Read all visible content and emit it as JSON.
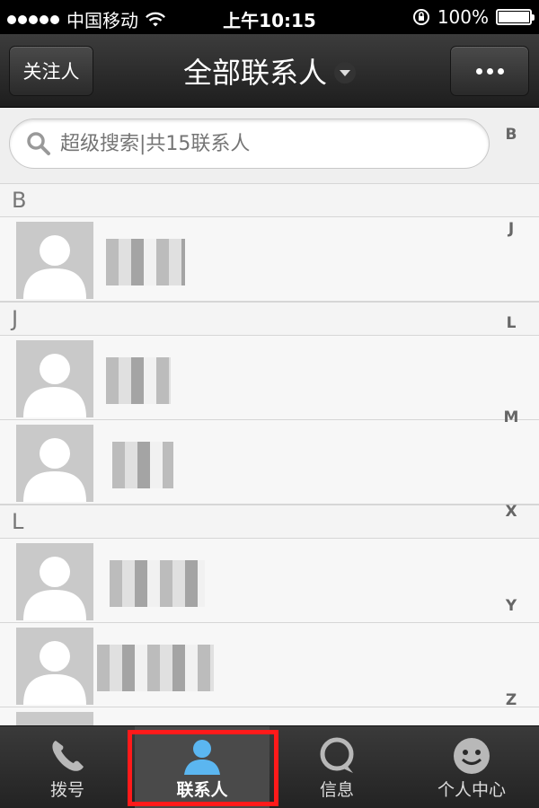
{
  "status_bar": {
    "carrier": "中国移动",
    "time": "上午10:15",
    "battery": "100%",
    "battery_level": 1.0
  },
  "nav": {
    "left_button": "关注人",
    "title": "全部联系人",
    "right_icon": "more-dots-icon"
  },
  "search": {
    "placeholder": "超级搜索|共15联系人",
    "icon": "search-icon"
  },
  "sections": [
    {
      "letter": "B",
      "contacts": [
        {
          "name_obscured": true
        }
      ]
    },
    {
      "letter": "J",
      "contacts": [
        {
          "name_obscured": true
        },
        {
          "name_obscured": true
        }
      ]
    },
    {
      "letter": "L",
      "contacts": [
        {
          "name_obscured": true
        },
        {
          "name_obscured": true
        },
        {
          "name_obscured": true
        }
      ]
    }
  ],
  "index": [
    "B",
    "J",
    "L",
    "M",
    "X",
    "Y",
    "Z"
  ],
  "tabs": [
    {
      "label": "拨号",
      "icon": "phone-icon",
      "active": false
    },
    {
      "label": "联系人",
      "icon": "contact-person-icon",
      "active": true
    },
    {
      "label": "信息",
      "icon": "message-bubble-icon",
      "active": false
    },
    {
      "label": "个人中心",
      "icon": "smiley-icon",
      "active": false
    }
  ],
  "colors": {
    "highlight": "#ff1a1a",
    "active_icon": "#5bb6f0",
    "header_bg": "#2a2a2a"
  }
}
